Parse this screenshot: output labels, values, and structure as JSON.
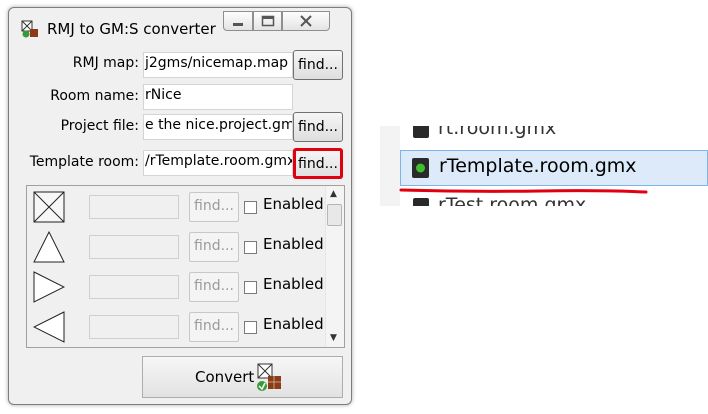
{
  "window": {
    "title": "RMJ to GM:S converter"
  },
  "form": {
    "rmj_map": {
      "label": "RMJ map:",
      "value": "j2gms/nicemap.map",
      "button": "find..."
    },
    "room_name": {
      "label": "Room name:",
      "value": "rNice"
    },
    "project_file": {
      "label": "Project file:",
      "value": "e the nice.project.gmx",
      "button": "find..."
    },
    "template_room": {
      "label": "Template room:",
      "value": "/rTemplate.room.gmx",
      "button": "find..."
    }
  },
  "panel": {
    "rows": [
      {
        "shape": "crossed-box-icon",
        "button": "find...",
        "checkbox_label": "Enabled",
        "checked": false
      },
      {
        "shape": "triangle-up-icon",
        "button": "find...",
        "checkbox_label": "Enabled",
        "checked": false
      },
      {
        "shape": "triangle-right-icon",
        "button": "find...",
        "checkbox_label": "Enabled",
        "checked": false
      },
      {
        "shape": "triangle-left-icon",
        "button": "find...",
        "checkbox_label": "Enabled",
        "checked": false
      }
    ]
  },
  "convert": {
    "label": "Convert"
  },
  "explorer": {
    "items": [
      {
        "name": "rt.room.gmx"
      },
      {
        "name": "rTemplate.room.gmx",
        "selected": true
      },
      {
        "name": "rTest.room.gmx"
      }
    ]
  },
  "colors": {
    "highlight": "#e00010",
    "selection": "#dceaf9"
  }
}
